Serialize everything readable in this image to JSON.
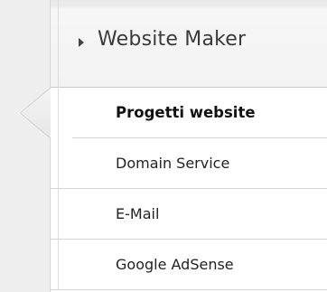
{
  "header": {
    "title": "Website Maker",
    "expand_icon": "triangle-right-icon"
  },
  "menu": {
    "items": [
      {
        "label": "Progetti website",
        "active": true
      },
      {
        "label": "Domain Service",
        "active": false
      },
      {
        "label": "E-Mail",
        "active": false
      },
      {
        "label": "Google AdSense",
        "active": false
      }
    ]
  },
  "colors": {
    "strip_bg": "#eeeeee",
    "header_bg": "#f3f3f3",
    "divider": "#d4d4d4",
    "text": "#222222"
  }
}
